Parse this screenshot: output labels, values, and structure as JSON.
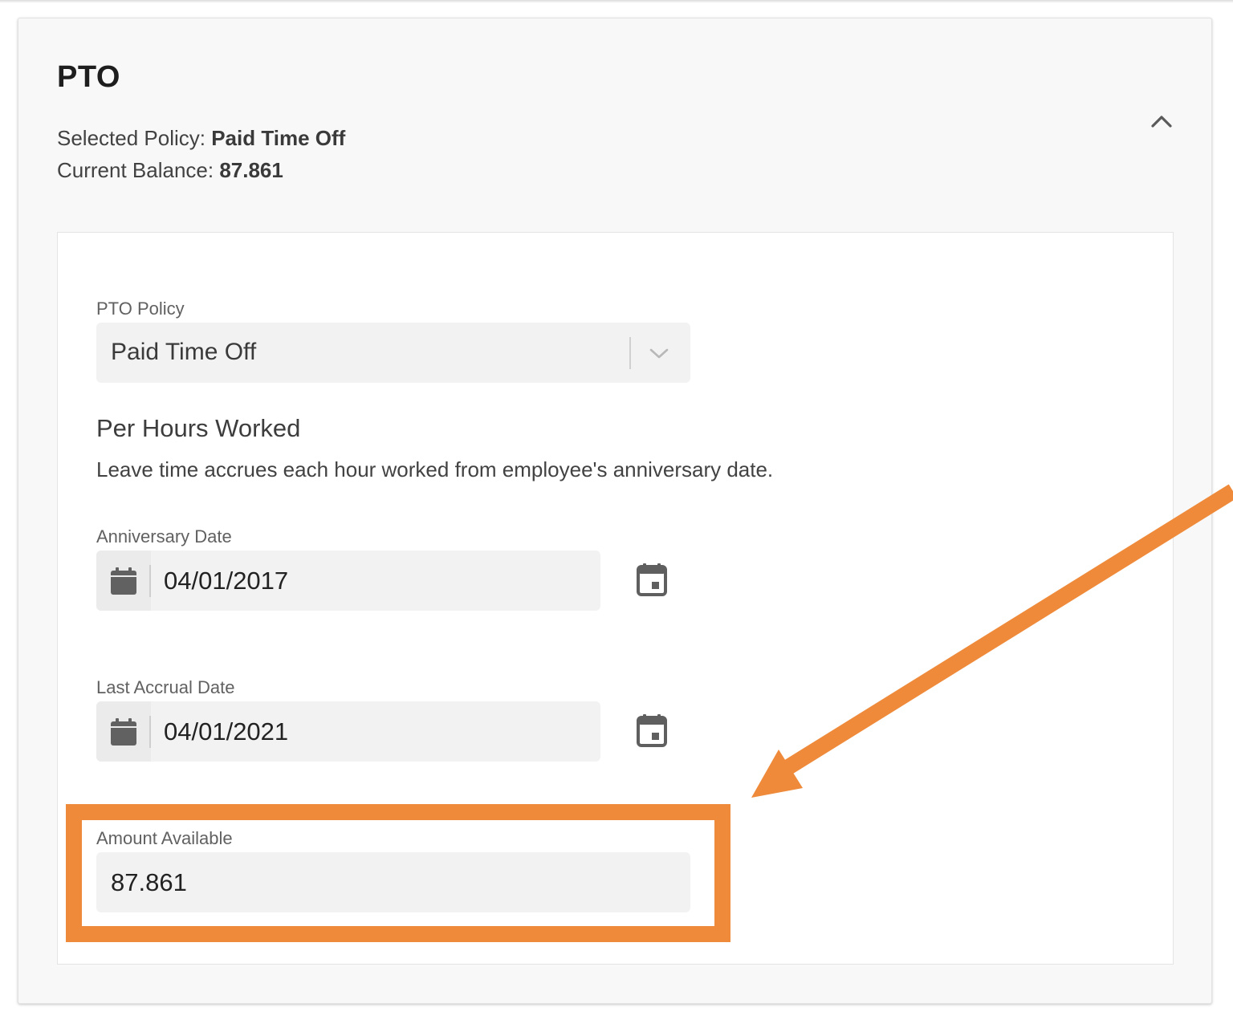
{
  "card": {
    "title": "PTO",
    "selected_policy_label": "Selected Policy: ",
    "selected_policy_value": "Paid Time Off",
    "current_balance_label": "Current Balance: ",
    "current_balance_value": "87.861",
    "collapse_icon": "chevron-up-icon"
  },
  "form": {
    "policy": {
      "label": "PTO Policy",
      "value": "Paid Time Off",
      "icon": "chevron-down-icon"
    },
    "accrual": {
      "heading": "Per Hours Worked",
      "description": "Leave time accrues each hour worked from employee's anniversary date."
    },
    "anniversary_date": {
      "label": "Anniversary Date",
      "value": "04/01/2017",
      "prefix_icon": "calendar-icon",
      "picker_icon": "calendar-event-icon"
    },
    "last_accrual_date": {
      "label": "Last Accrual Date",
      "value": "04/01/2021",
      "prefix_icon": "calendar-icon",
      "picker_icon": "calendar-event-icon"
    },
    "amount_available": {
      "label": "Amount Available",
      "value": "87.861"
    }
  },
  "annotation": {
    "color": "#ee8a3a",
    "shapes": [
      "highlight-box",
      "arrow"
    ]
  },
  "colors": {
    "card_bg": "#f8f8f8",
    "field_bg": "#f2f2f2",
    "accent": "#ee8a3a",
    "icon": "#5f5f5f"
  }
}
